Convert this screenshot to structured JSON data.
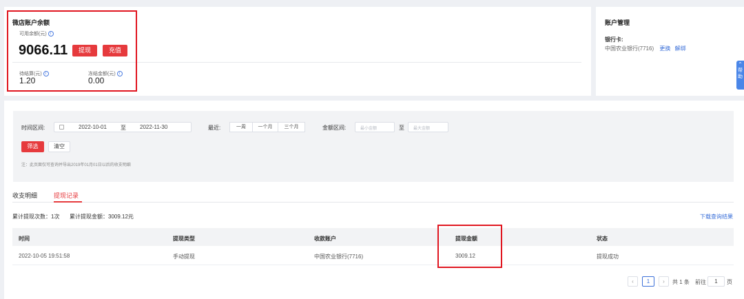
{
  "wallet": {
    "title": "微店账户余额",
    "available_label": "可用余额(元)",
    "available_value": "9066.11",
    "withdraw_button": "提现",
    "recharge_button": "充值",
    "pending_label": "待结算(元)",
    "pending_value": "1.20",
    "frozen_label": "冻结金额(元)",
    "frozen_value": "0.00"
  },
  "account": {
    "title": "账户管理",
    "bank_label": "银行卡:",
    "bank_value": "中国农业银行(7716)",
    "change_link": "更换",
    "unbind_link": "解绑",
    "help_tab": "帮助"
  },
  "filter": {
    "time_label": "时间区间:",
    "start_date": "2022-10-01",
    "to_label": "至",
    "end_date": "2022-11-30",
    "recent_label": "最近:",
    "recent_options": [
      "一周",
      "一个月",
      "三个月"
    ],
    "amount_label": "金额区间:",
    "min_placeholder": "最小金额",
    "max_placeholder": "最大金额",
    "filter_button": "筛选",
    "clear_button": "清空",
    "note": "注：此页面仅可查询并导出2019年01月01日以后的收支明细"
  },
  "tabs": [
    "收支明细",
    "提现记录"
  ],
  "summary": {
    "count_text": "累计提现次数：1次",
    "amount_text": "累计提现金额：3009.12元",
    "download_link": "下载查询结果"
  },
  "table": {
    "headers": [
      "时间",
      "提现类型",
      "收款账户",
      "提现金额",
      "状态"
    ],
    "rows": [
      [
        "2022-10-05 19:51:58",
        "手动提现",
        "中国农业银行(7716)",
        "3009.12",
        "提现成功"
      ]
    ]
  },
  "pagination": {
    "prev_icon": "chevron-left-icon",
    "next_icon": "chevron-right-icon",
    "current_page": "1",
    "total_text": "共 1 条",
    "goto_label": "前往",
    "goto_value": "1",
    "page_suffix": "页"
  },
  "colors": {
    "accent_red": "#e63a3d",
    "link_blue": "#3a6fd8",
    "highlight_box": "#e0151f"
  }
}
